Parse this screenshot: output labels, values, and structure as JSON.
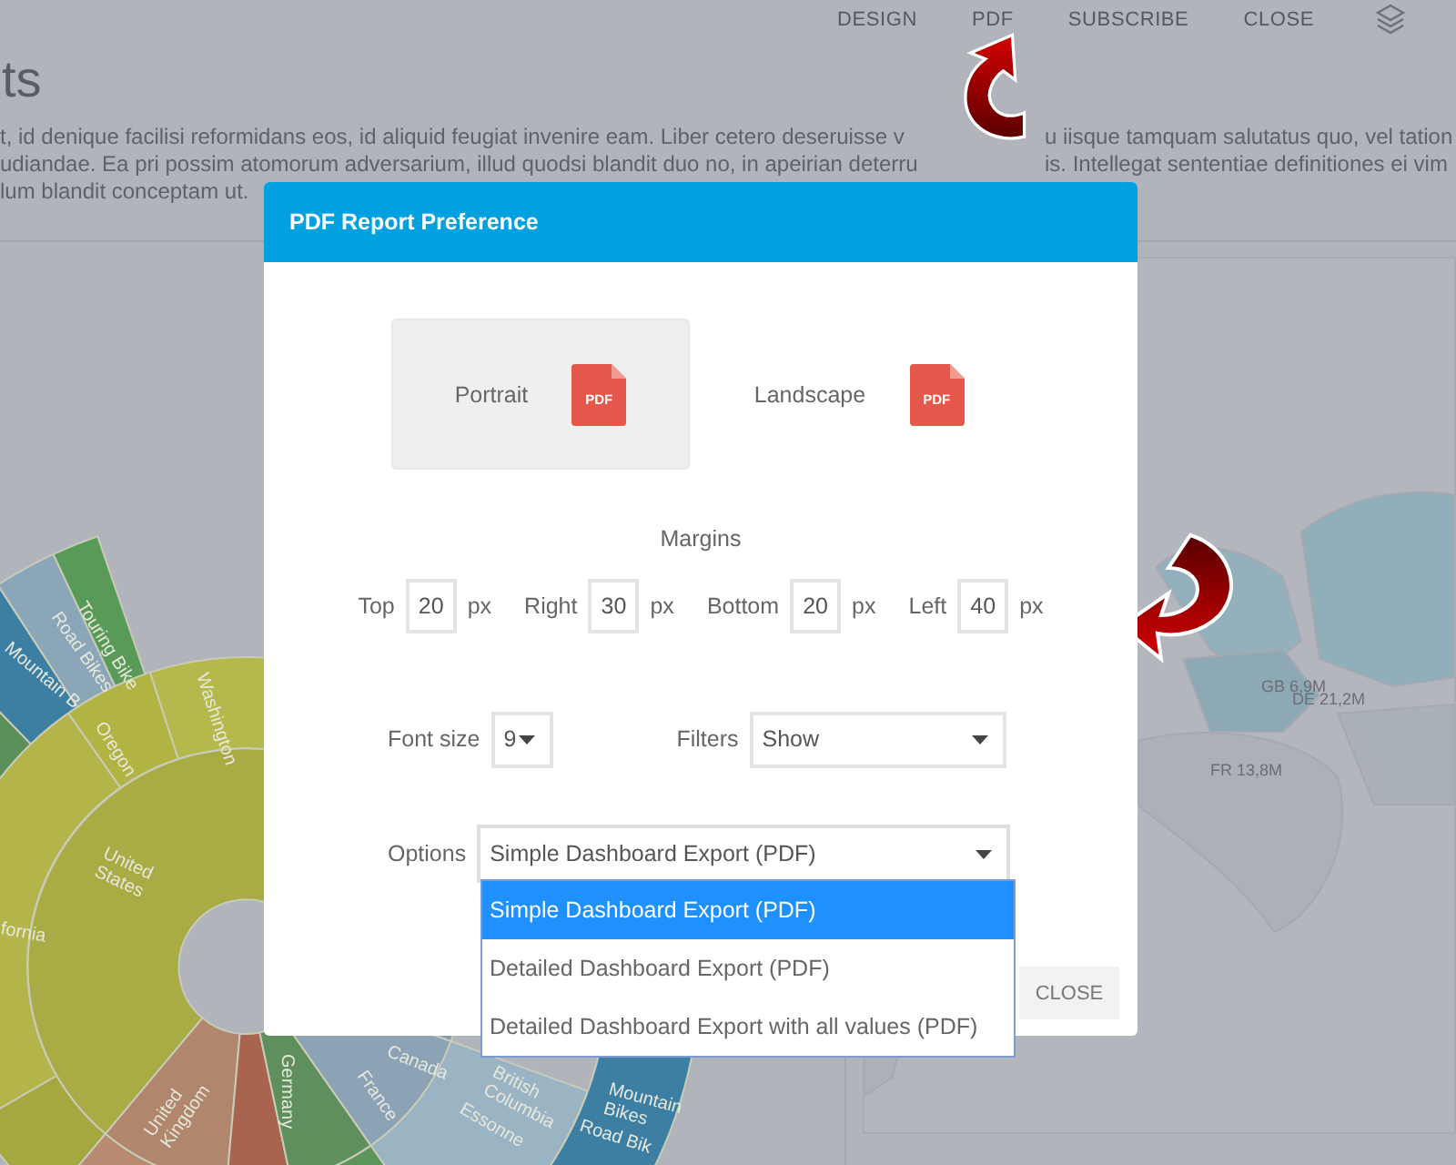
{
  "nav": {
    "items": [
      "DESIGN",
      "PDF",
      "SUBSCRIBE",
      "CLOSE"
    ]
  },
  "page": {
    "title": "ts",
    "paragraph_lines": [
      [
        "t, id denique facilisi reformidans eos, id aliquid feugiat invenire eam. Liber cetero deseruisse v",
        "u iisque tamquam salutatus quo, vel tation"
      ],
      [
        "udiandae. Ea pri possim atomorum adversarium, illud quodsi blandit duo no, in apeirian deterru",
        "is. Intellegat sententiae definitiones ei vim"
      ],
      [
        "lum blandit conceptam ut."
      ]
    ]
  },
  "sunburst": {
    "labels": [
      "Touring Bike",
      "Road Bikes",
      "Mountain B",
      "Washington",
      "Oregon",
      "United States",
      "fornia",
      "United Kingdom",
      "Germany",
      "France",
      "Canada",
      "British Columbia",
      "Mountain Bikes",
      "Road Bik",
      "Essonne"
    ]
  },
  "map": {
    "labels": [
      "GB 6,9M",
      "DE 21,2M",
      "FR 13,8M"
    ]
  },
  "dialog": {
    "title": "PDF Report Preference",
    "orientations": [
      {
        "label": "Portrait",
        "icon_text": "PDF",
        "selected": true
      },
      {
        "label": "Landscape",
        "icon_text": "PDF",
        "selected": false
      }
    ],
    "margins": {
      "label": "Margins",
      "fields": [
        {
          "label": "Top",
          "value": "20",
          "unit": "px"
        },
        {
          "label": "Right",
          "value": "30",
          "unit": "px"
        },
        {
          "label": "Bottom",
          "value": "20",
          "unit": "px"
        },
        {
          "label": "Left",
          "value": "40",
          "unit": "px"
        }
      ]
    },
    "font_size": {
      "label": "Font size",
      "value": "9"
    },
    "filters": {
      "label": "Filters",
      "value": "Show"
    },
    "options": {
      "label": "Options",
      "value": "Simple Dashboard Export (PDF)",
      "expanded": true,
      "items": [
        {
          "label": "Simple Dashboard Export (PDF)",
          "selected": true
        },
        {
          "label": "Detailed Dashboard Export (PDF)",
          "selected": false
        },
        {
          "label": "Detailed Dashboard Export with all values (PDF)",
          "selected": false
        }
      ]
    },
    "buttons": [
      "CLOSE"
    ]
  }
}
